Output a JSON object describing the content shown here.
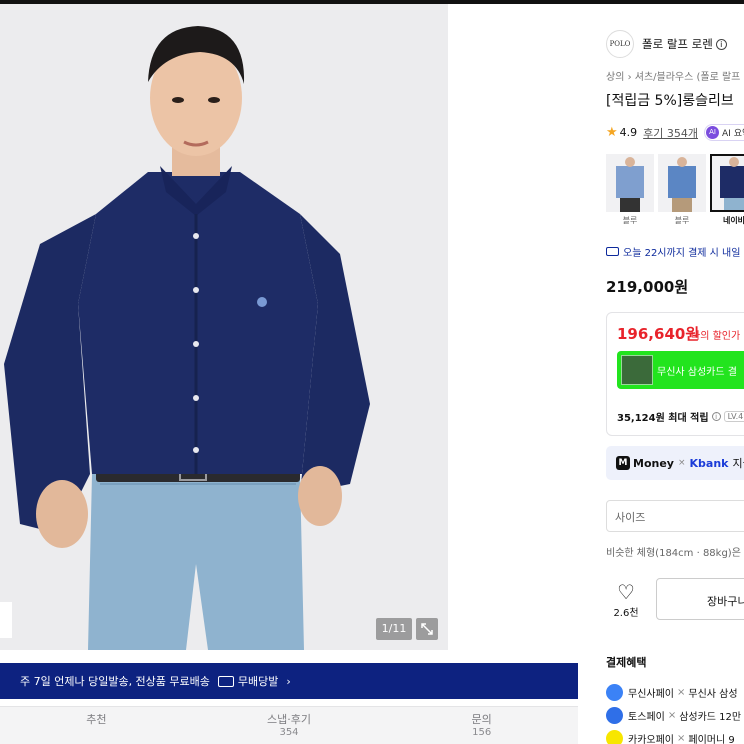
{
  "gallery": {
    "counter": "1/11"
  },
  "banner": {
    "text": "주 7일 언제나 당일발송, 전상품 무료배송",
    "badge_label": "무배당발",
    "chevron": "›"
  },
  "tabs": [
    {
      "label": "추천",
      "count": ""
    },
    {
      "label": "스냅·후기",
      "count": "354"
    },
    {
      "label": "문의",
      "count": "156"
    }
  ],
  "brand": {
    "logo_text": "POLO",
    "name": "폴로 랄프 로렌",
    "info_icon": "i"
  },
  "breadcrumb": "상의 › 셔츠/블라우스 (폴로 랄프",
  "product_title": "[적립금 5%]롱슬리브",
  "rating": {
    "score": "4.9",
    "reviews_link": "후기 354개",
    "ai_label": "AI 요약"
  },
  "swatches": [
    {
      "label": "블루"
    },
    {
      "label": "블루"
    },
    {
      "label": "네이비"
    }
  ],
  "delivery_note": "오늘 22시까지 결제 시 내일",
  "price": "219,000원",
  "discount": {
    "price": "196,640원",
    "note": "나의 할인가",
    "card_promo": "무신사 삼성카드 결",
    "points": "35,124원 최대 적립",
    "level": "LV.4"
  },
  "kbank_promo": {
    "money": "Money",
    "kbank": "Kbank",
    "tail": "지금"
  },
  "size_select": {
    "placeholder": "사이즈"
  },
  "fit_note": "비슷한 체형(184cm · 88kg)은",
  "actions": {
    "likes": "2.6천",
    "cart_label": "장바구니"
  },
  "payment_benefits": {
    "title": "결제혜택",
    "rows": [
      {
        "a": "무신사페이",
        "b": "무신사 삼성",
        "color": "#3b82f6"
      },
      {
        "a": "토스페이",
        "b": "삼성카드 12만",
        "color": "#2f6fe8"
      },
      {
        "a": "카카오페이",
        "b": "페이머니 9",
        "color": "#f7e600"
      }
    ]
  },
  "colors": {
    "banner_bg": "#0d2280",
    "discount_red": "#e8232b",
    "promo_green": "#22e41e",
    "delivery_blue": "#0d2a9c"
  }
}
